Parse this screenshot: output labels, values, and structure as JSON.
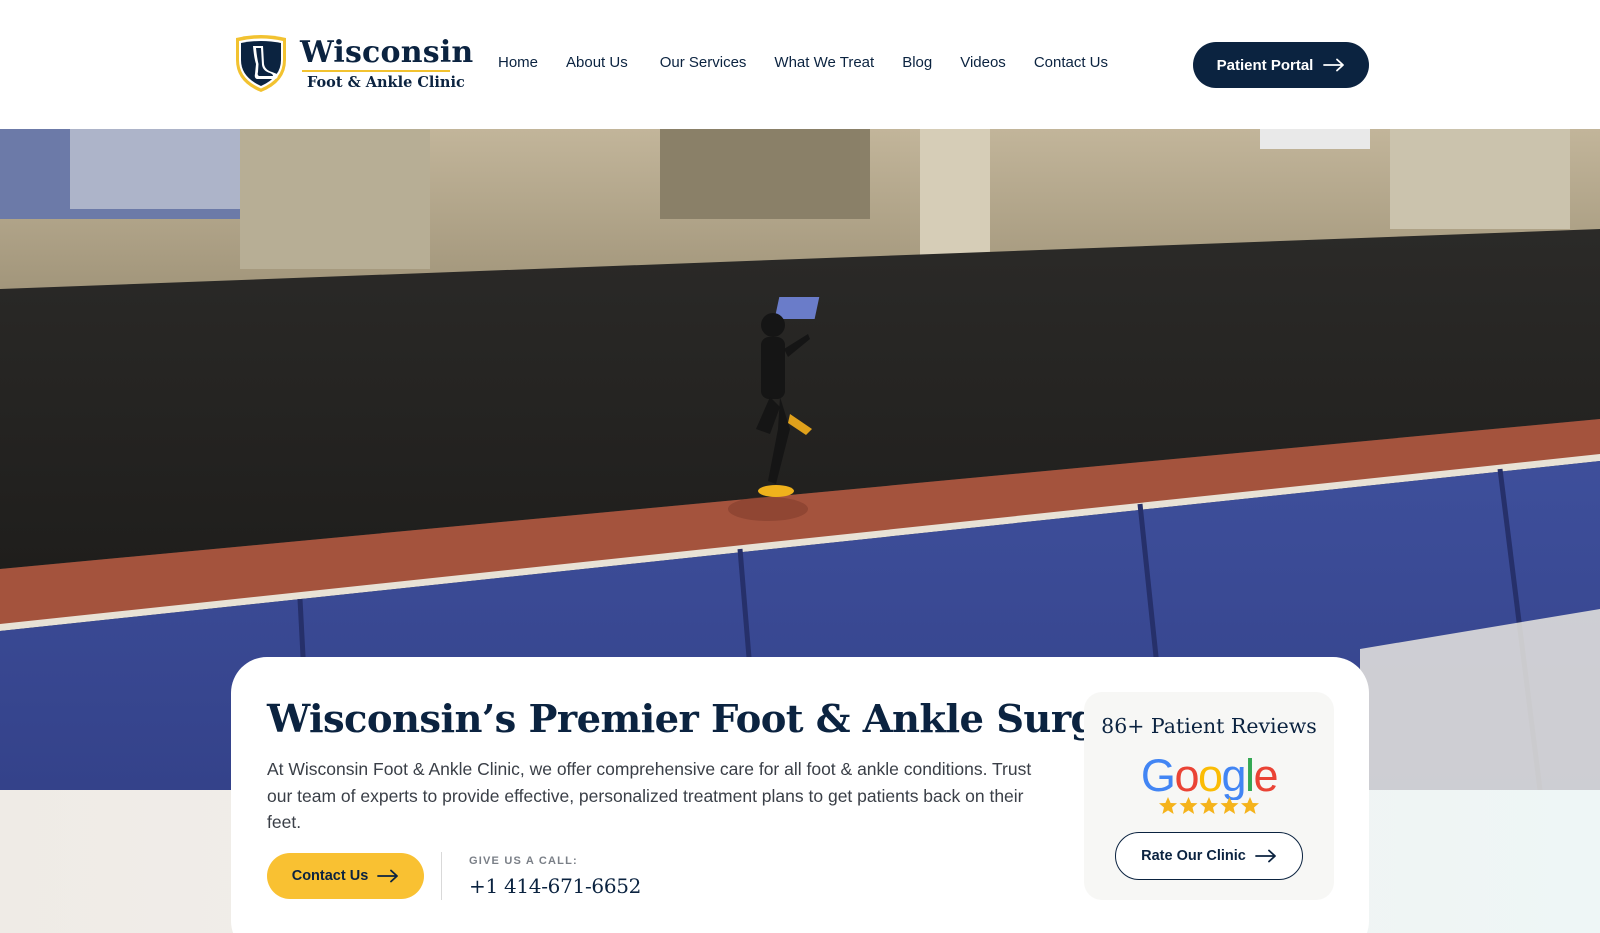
{
  "brand": {
    "title": "Wisconsin",
    "subtitle": "Foot & Ankle Clinic",
    "colors": {
      "navy": "#0b2340",
      "gold": "#f9c132"
    }
  },
  "nav": {
    "items": [
      {
        "label": "Home"
      },
      {
        "label": "About Us"
      },
      {
        "label": "Our Services"
      },
      {
        "label": "What We Treat"
      },
      {
        "label": "Blog"
      },
      {
        "label": "Videos"
      },
      {
        "label": "Contact Us"
      }
    ],
    "portal_label": "Patient Portal"
  },
  "hero": {
    "heading": "Wisconsin’s Premier Foot & Ankle Surgeons",
    "description": "At Wisconsin Foot & Ankle Clinic, we offer comprehensive care for all foot & ankle conditions. Trust our team of experts to provide effective, personalized treatment plans to get patients back on their feet.",
    "contact_label": "Contact Us",
    "call_label": "GIVE US A CALL:",
    "phone": "+1 414-671-6652"
  },
  "reviews": {
    "title": "86+ Patient Reviews",
    "google_text": "Google",
    "rating_stars": 5,
    "rate_label": "Rate Our Clinic"
  }
}
